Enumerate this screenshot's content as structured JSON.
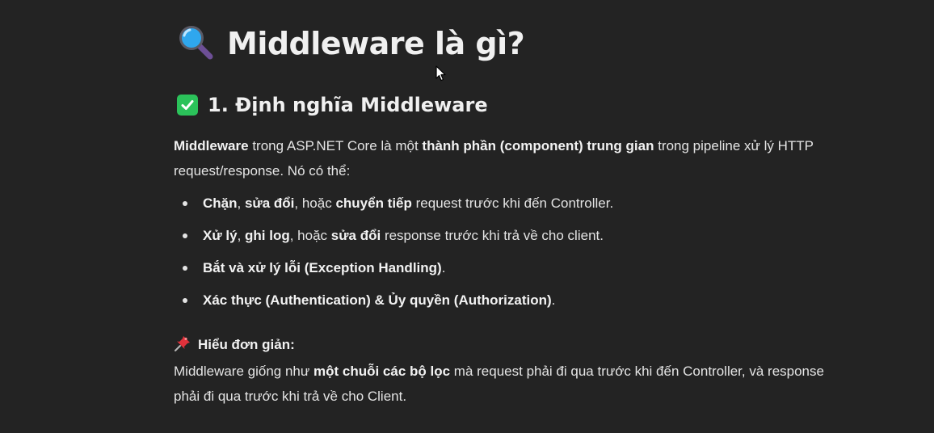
{
  "heading": {
    "icon": "magnifying-glass-icon",
    "text": "Middleware là gì?"
  },
  "section1": {
    "icon": "check-mark-button-icon",
    "text": "1. Định nghĩa Middleware"
  },
  "intro": {
    "b1": "Middleware",
    "t1": " trong ASP.NET Core là một ",
    "b2": "thành phần (component) trung gian",
    "t2": " trong pipeline xử lý HTTP request/response. Nó có thể:"
  },
  "bullets": [
    {
      "b1": "Chặn",
      "t1": ", ",
      "b2": "sửa đổi",
      "t2": ", hoặc ",
      "b3": "chuyển tiếp",
      "t3": " request trước khi đến Controller."
    },
    {
      "b1": "Xử lý",
      "t1": ", ",
      "b2": "ghi log",
      "t2": ", hoặc ",
      "b3": "sửa đổi",
      "t3": " response trước khi trả về cho client."
    },
    {
      "b1": "Bắt và xử lý lỗi (Exception Handling)",
      "t1": "."
    },
    {
      "b1": "Xác thực (Authentication) & Ủy quyền (Authorization)",
      "t1": "."
    }
  ],
  "note": {
    "icon": "pushpin-icon",
    "label": "Hiểu đơn giản:",
    "t1": "Middleware giống như ",
    "b1": "một chuỗi các bộ lọc",
    "t2": " mà request phải đi qua trước khi đến Controller, và response phải đi qua trước khi trả về cho Client."
  },
  "colors": {
    "background": "#232323",
    "text": "#e4e4e4",
    "check_green": "#2bc25a",
    "pin_red": "#e0313b"
  }
}
